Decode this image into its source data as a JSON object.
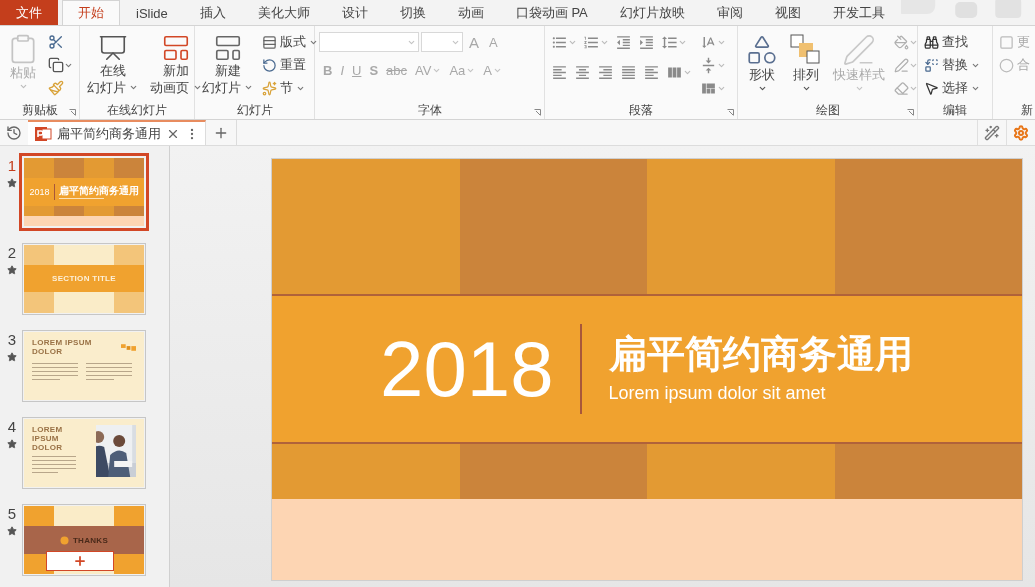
{
  "menu_tabs": [
    {
      "label": "文件",
      "kind": "file",
      "selected": false
    },
    {
      "label": "开始",
      "kind": "tab",
      "selected": true
    },
    {
      "label": "iSlide",
      "kind": "tab",
      "selected": false
    },
    {
      "label": "插入",
      "kind": "tab",
      "selected": false
    },
    {
      "label": "美化大师",
      "kind": "tab",
      "selected": false
    },
    {
      "label": "设计",
      "kind": "tab",
      "selected": false
    },
    {
      "label": "切换",
      "kind": "tab",
      "selected": false
    },
    {
      "label": "动画",
      "kind": "tab",
      "selected": false
    },
    {
      "label": "口袋动画 PA",
      "kind": "tab",
      "selected": false
    },
    {
      "label": "幻灯片放映",
      "kind": "tab",
      "selected": false
    },
    {
      "label": "审阅",
      "kind": "tab",
      "selected": false
    },
    {
      "label": "视图",
      "kind": "tab",
      "selected": false
    },
    {
      "label": "开发工具",
      "kind": "tab",
      "selected": false
    }
  ],
  "ribbon": {
    "clipboard": {
      "title": "剪贴板",
      "paste": {
        "label": "粘贴",
        "disabled": true
      }
    },
    "online": {
      "title": "在线幻灯片",
      "buttons": [
        {
          "lines": [
            "在线",
            "幻灯片"
          ],
          "disabled": false
        },
        {
          "lines": [
            "新加",
            "动画页"
          ],
          "disabled": false
        }
      ]
    },
    "slides": {
      "title": "幻灯片",
      "new_slide": {
        "lines": [
          "新建",
          "幻灯片"
        ],
        "disabled": false
      },
      "small": [
        {
          "label": "版式",
          "disabled": false
        },
        {
          "label": "重置",
          "disabled": false
        },
        {
          "label": "节",
          "disabled": false
        }
      ]
    },
    "font": {
      "title": "字体",
      "size_buttons": [
        {
          "label": "A",
          "disabled": true
        },
        {
          "label": "A",
          "disabled": true
        }
      ],
      "format_buttons": [
        {
          "label": "B",
          "disabled": true
        },
        {
          "label": "I",
          "disabled": true
        },
        {
          "label": "U",
          "disabled": true
        },
        {
          "label": "S",
          "disabled": true
        },
        {
          "label": "abc",
          "disabled": true
        },
        {
          "label": "AV",
          "disabled": true
        },
        {
          "label": "Aa",
          "disabled": true
        },
        {
          "label": "A",
          "disabled": true
        }
      ]
    },
    "paragraph": {
      "title": "段落"
    },
    "drawing": {
      "title": "绘图",
      "buttons": [
        {
          "label": "形状",
          "disabled": false
        },
        {
          "label": "排列",
          "disabled": false
        },
        {
          "label": "快速样式",
          "disabled": true
        }
      ]
    },
    "editing": {
      "title": "编辑",
      "buttons": [
        {
          "label": "查找",
          "disabled": false
        },
        {
          "label": "替换",
          "disabled": false
        },
        {
          "label": "选择",
          "disabled": false
        }
      ]
    },
    "new_group": {
      "title": "新",
      "buttons": [
        {
          "label": "更",
          "disabled": true
        },
        {
          "label": "合",
          "disabled": true
        }
      ]
    }
  },
  "document_tab": {
    "title": "扁平简约商务通用"
  },
  "slides": [
    {
      "number": "1",
      "kind": "title",
      "selected": true,
      "year": "2018",
      "title": "扁平简约商务通用"
    },
    {
      "number": "2",
      "kind": "section",
      "selected": false,
      "title": "SECTION TITLE"
    },
    {
      "number": "3",
      "kind": "text",
      "selected": false,
      "title": "LOREM IPSUM DOLOR"
    },
    {
      "number": "4",
      "selected": false,
      "title": "LOREM IPSUM DOLOR"
    },
    {
      "number": "5",
      "kind": "thanks",
      "selected": false,
      "title": "THANKS"
    }
  ],
  "slide": {
    "year": "2018",
    "title": "扁平简约商务通用",
    "subtitle": "Lorem ipsum dolor sit amet"
  }
}
